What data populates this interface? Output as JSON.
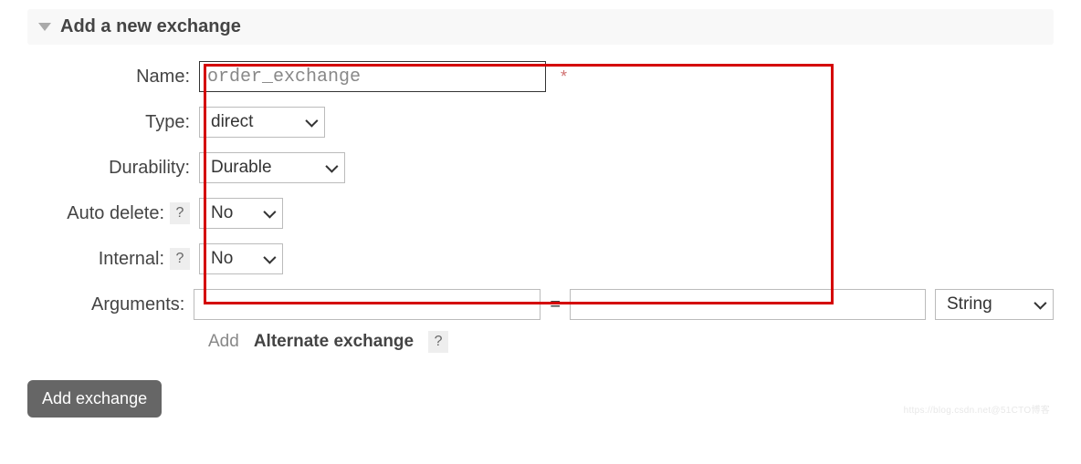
{
  "section": {
    "title": "Add a new exchange"
  },
  "form": {
    "name": {
      "label": "Name:",
      "value": "order_exchange",
      "required_marker": "*"
    },
    "type": {
      "label": "Type:",
      "value": "direct"
    },
    "durability": {
      "label": "Durability:",
      "value": "Durable"
    },
    "auto_delete": {
      "label": "Auto delete:",
      "value": "No",
      "help": "?"
    },
    "internal": {
      "label": "Internal:",
      "value": "No",
      "help": "?"
    },
    "arguments": {
      "label": "Arguments:",
      "key": "",
      "equals": "=",
      "value": "",
      "type_value": "String"
    },
    "shortcuts": {
      "add_label": "Add",
      "alternate_exchange": "Alternate exchange",
      "help": "?"
    },
    "submit_label": "Add exchange"
  },
  "watermark": "https://blog.csdn.net@51CTO博客"
}
